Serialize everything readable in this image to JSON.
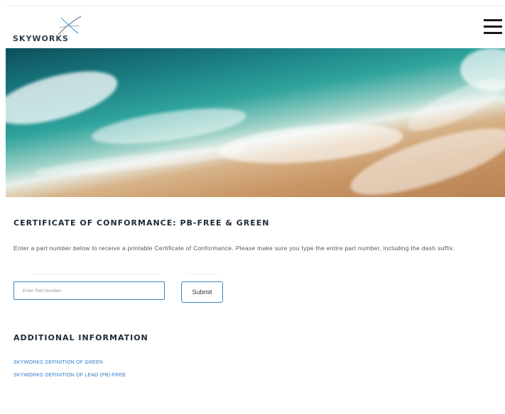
{
  "header": {
    "logo_text": "SKYWORKS",
    "logo_icon": "skyworks-x-icon",
    "menu_icon": "hamburger-menu-icon"
  },
  "hero": {
    "description": "ocean waves on sandy beach aerial photo"
  },
  "main": {
    "title": "CERTIFICATE OF CONFORMANCE: PB-FREE & GREEN",
    "description": "Enter a part number below to receive a printable Certificate of Conformance. Please make sure you type the entire part number, including the dash suffix.",
    "input": {
      "placeholder": "Enter Part Number",
      "value": ""
    },
    "submit_label": "Submit"
  },
  "additional": {
    "title": "ADDITIONAL INFORMATION",
    "links": [
      "SKYWORKS DEFINITION OF GREEN",
      "SKYWORKS DEFINITION OF LEAD (PB)-FREE"
    ]
  },
  "colors": {
    "accent": "#3a87c0",
    "link": "#2a7cc7",
    "heading": "#1e2a36"
  }
}
